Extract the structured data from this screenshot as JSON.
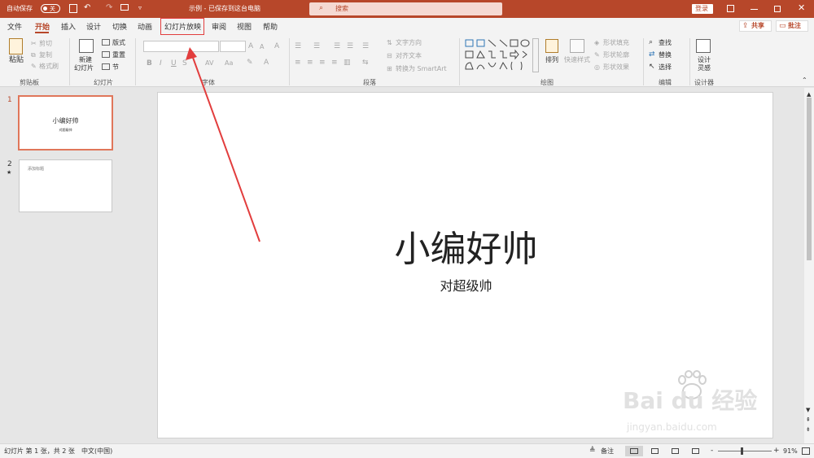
{
  "titlebar": {
    "autosave_label": "自动保存",
    "autosave_state": "关",
    "doc_title": "示例 - 已保存到这台电脑",
    "search_label": "搜索",
    "login_label": "登录"
  },
  "tabs": [
    "文件",
    "开始",
    "插入",
    "设计",
    "切换",
    "动画",
    "幻灯片放映",
    "审阅",
    "视图",
    "帮助"
  ],
  "share_label": "共享",
  "comment_label": "批注",
  "ribbon": {
    "paste": "粘贴",
    "cut": "剪切",
    "copy": "复制",
    "format_painter": "格式刷",
    "clipboard_group": "剪贴板",
    "new_slide_1": "新建",
    "new_slide_2": "幻灯片",
    "layout": "版式",
    "reset": "重置",
    "section": "节",
    "slides_group": "幻灯片",
    "font_group": "字体",
    "font_buttons": [
      "B",
      "I",
      "U",
      "S"
    ],
    "aa_label": "Aa",
    "text_direction": "文字方向",
    "align_text": "对齐文本",
    "smartart": "转换为 SmartArt",
    "paragraph_group": "段落",
    "arrange": "排列",
    "quick_styles": "快速样式",
    "shape_fill": "形状填充",
    "shape_outline": "形状轮廓",
    "shape_effects": "形状效果",
    "drawing_group": "绘图",
    "find": "查找",
    "replace": "替换",
    "select": "选择",
    "editing_group": "编辑",
    "design_ideas_1": "设计",
    "design_ideas_2": "灵感",
    "designer_group": "设计器"
  },
  "slide_panel": {
    "slide1_number": "1",
    "slide1_title": "小编好帅",
    "slide1_subtitle": "对超级帅",
    "slide2_number": "2",
    "slide2_star": "★",
    "slide2_text": "添加标题"
  },
  "slide": {
    "title": "小编好帅",
    "subtitle": "对超级帅"
  },
  "status": {
    "slide_info": "幻灯片 第 1 张，共 2 张",
    "language": "中文(中国)",
    "notes": "备注",
    "zoom_minus": "-",
    "zoom_plus": "+",
    "zoom": "91%"
  },
  "watermark": {
    "text": "Bai du 经验",
    "url": "jingyan.baidu.com"
  },
  "colors": {
    "accent": "#b7472a",
    "highlight": "#e23d3d",
    "ribbon_bg": "#f3f3f3"
  }
}
